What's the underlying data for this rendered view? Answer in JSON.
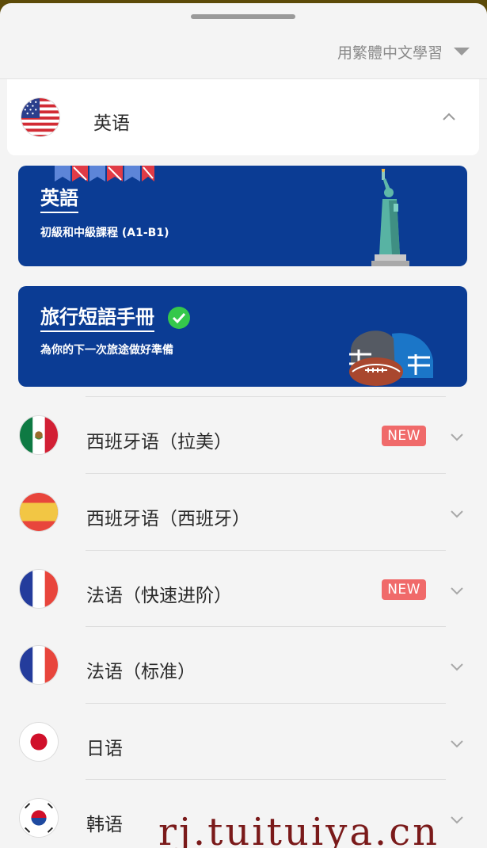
{
  "header": {
    "interface_language": "用繁體中文學習"
  },
  "selected_course": {
    "label": "英语",
    "flag": "us-flag-icon"
  },
  "course_cards": [
    {
      "title": "英語",
      "subtitle": "初級和中級課程 (A1-B1)",
      "illustration": "statue-of-liberty-icon",
      "color": "#0b3c94"
    },
    {
      "title": "旅行短語手冊",
      "subtitle": "為你的下一次旅途做好準備",
      "illustration": "football-helmet-icon",
      "completed": true,
      "color": "#0b3c94"
    }
  ],
  "languages": [
    {
      "label": "西班牙语（拉美）",
      "flag": "mexico-flag-icon",
      "badge": "NEW"
    },
    {
      "label": "西班牙语（西班牙）",
      "flag": "spain-flag-icon",
      "badge": ""
    },
    {
      "label": "法语（快速进阶）",
      "flag": "france-flag-icon",
      "badge": "NEW"
    },
    {
      "label": "法语（标准）",
      "flag": "france-flag-icon",
      "badge": ""
    },
    {
      "label": "日语",
      "flag": "japan-flag-icon",
      "badge": ""
    },
    {
      "label": "韩语",
      "flag": "korea-flag-icon",
      "badge": ""
    }
  ],
  "watermark": "rj.tuituiya.cn"
}
